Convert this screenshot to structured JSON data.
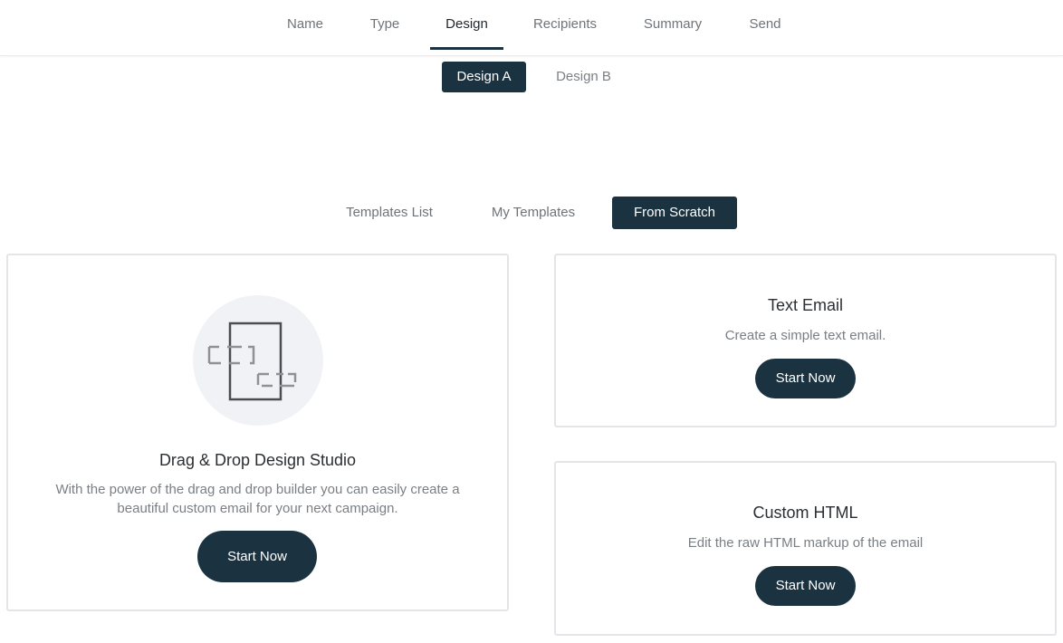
{
  "steps": [
    {
      "label": "Name"
    },
    {
      "label": "Type"
    },
    {
      "label": "Design",
      "active": true
    },
    {
      "label": "Recipients"
    },
    {
      "label": "Summary"
    },
    {
      "label": "Send"
    }
  ],
  "variants": {
    "design_a": "Design A",
    "design_b": "Design B",
    "selected": "Design A"
  },
  "source_tabs": {
    "templates_list": "Templates List",
    "my_templates": "My Templates",
    "from_scratch": "From Scratch",
    "selected": "From Scratch"
  },
  "cards": {
    "drag_drop": {
      "title": "Drag & Drop Design Studio",
      "description_line1": "With the power of the drag and drop builder you can easily create a",
      "description_line2": "beautiful custom email for your next campaign.",
      "button": "Start Now",
      "illustration_icon": "drag-drop-layout-icon"
    },
    "text_email": {
      "title": "Text Email",
      "description": "Create a simple text email.",
      "button": "Start Now"
    },
    "custom_html": {
      "title": "Custom HTML",
      "description": "Edit the raw HTML markup of the email",
      "button": "Start Now"
    }
  },
  "colors": {
    "primary": "#1b3340",
    "muted_text": "#7a7f84",
    "border": "#e3e5e8",
    "illustration_bg": "#f1f2f6"
  }
}
